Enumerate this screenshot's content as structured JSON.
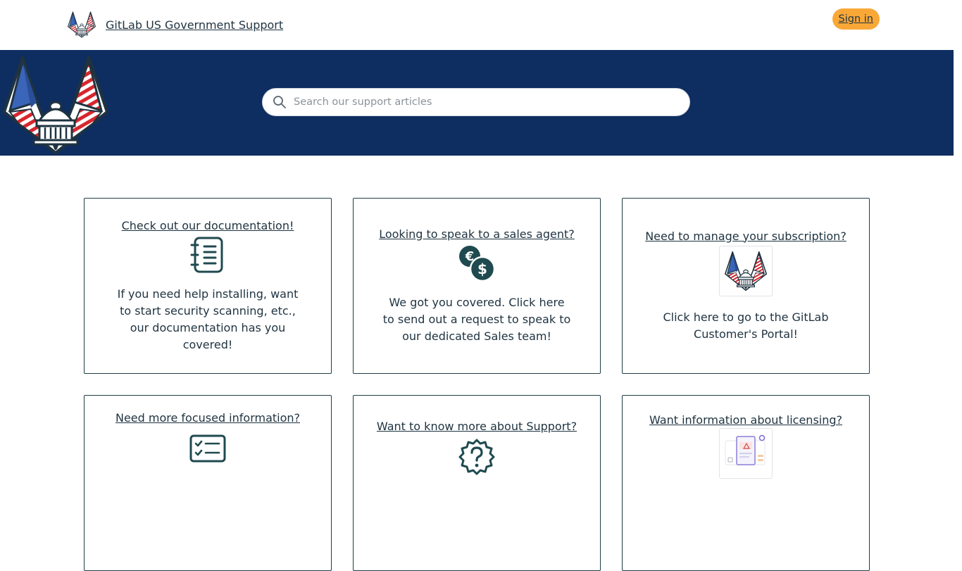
{
  "header": {
    "brand_link": "GitLab US Government Support",
    "signin_label": "Sign in"
  },
  "search": {
    "placeholder": "Search our support articles"
  },
  "cards": [
    {
      "title": "Check out our documentation!",
      "icon": "notebook-icon",
      "description": "If you need help installing, want to start security scanning, etc., our documentation has you covered!"
    },
    {
      "title": "Looking to speak to a sales agent?",
      "icon": "currency-coins-icon",
      "description": "We got you covered. Click here to send out a request to speak to our dedicated Sales team!"
    },
    {
      "title": "Need to manage your subscription?",
      "icon": "gitlab-gov-logo-icon",
      "description": "Click here to go to the GitLab Customer's Portal!"
    },
    {
      "title": "Need more focused information?",
      "icon": "checklist-icon",
      "description": ""
    },
    {
      "title": "Want to know more about Support?",
      "icon": "question-badge-icon",
      "description": ""
    },
    {
      "title": "Want information about licensing?",
      "icon": "license-document-icon",
      "description": ""
    }
  ],
  "colors": {
    "hero_background": "#0e2d60",
    "signin_background": "#f9a838",
    "text_primary": "#1f3340",
    "card_border": "#1f3d47"
  }
}
